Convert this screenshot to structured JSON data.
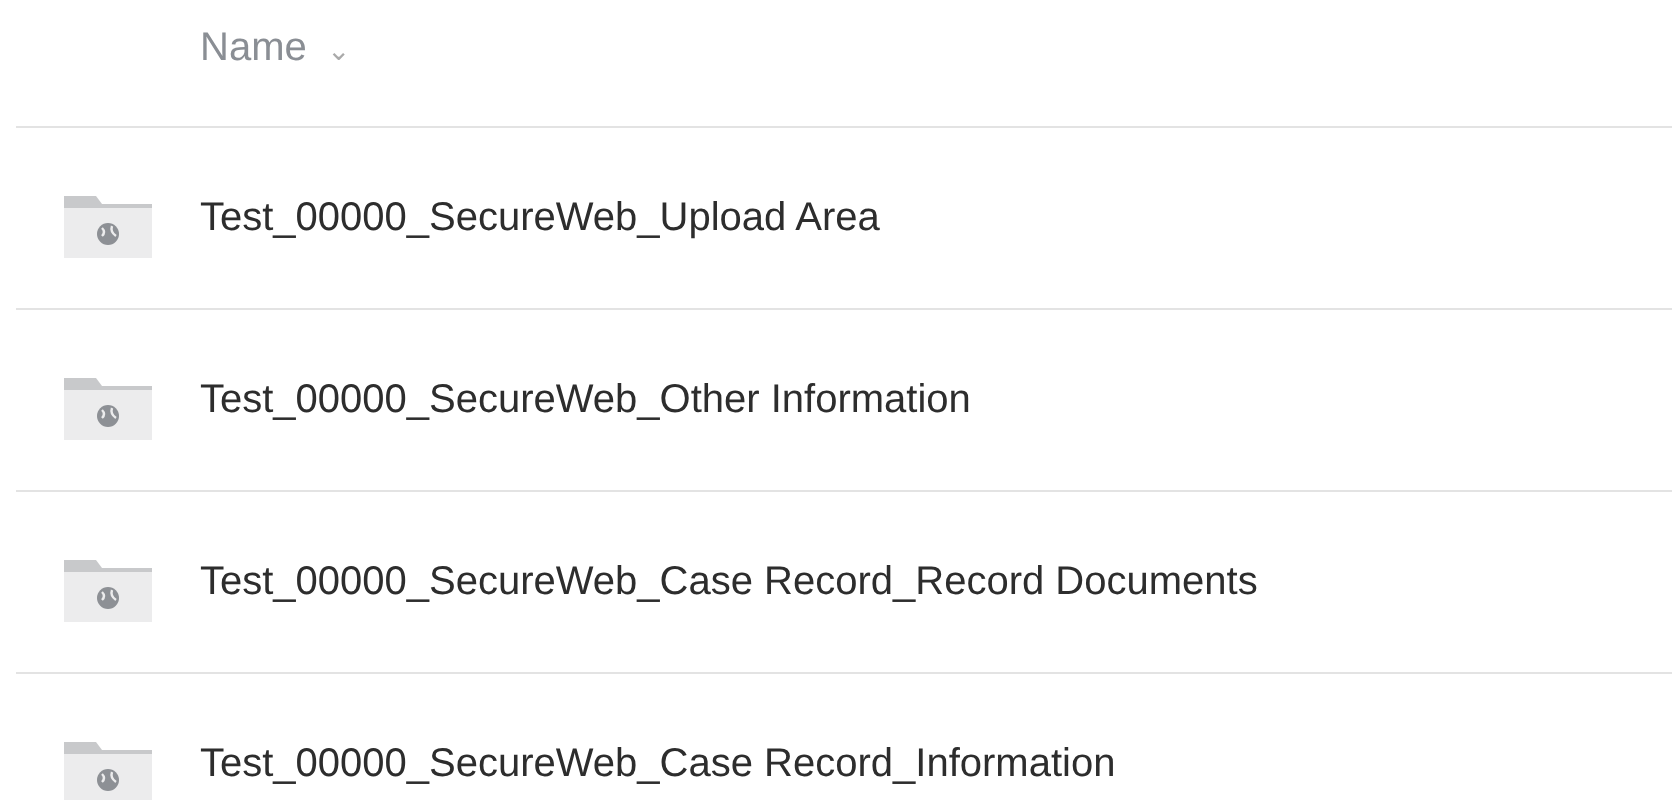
{
  "header": {
    "label": "Name",
    "sort_icon": "⌄"
  },
  "rows": [
    {
      "name": "Test_00000_SecureWeb_Upload Area"
    },
    {
      "name": "Test_00000_SecureWeb_Other Information"
    },
    {
      "name": "Test_00000_SecureWeb_Case Record_Record Documents"
    },
    {
      "name": "Test_00000_SecureWeb_Case Record_Information"
    }
  ]
}
